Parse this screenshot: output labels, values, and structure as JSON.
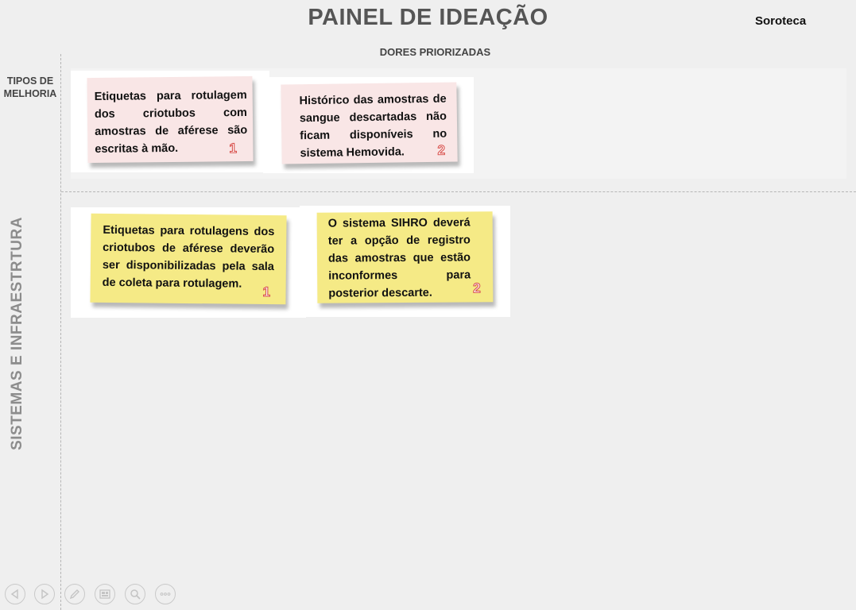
{
  "header": {
    "title": "PAINEL DE IDEAÇÃO",
    "organization": "Soroteca",
    "column_heading": "DORES PRIORIZADAS"
  },
  "rows": {
    "top_label": "TIPOS DE MELHORIA",
    "side_label": "SISTEMAS E INFRAESTRTURA"
  },
  "pain_cards": [
    {
      "text": "Etiquetas para rotulagem dos criotubos com amostras de aférese são escritas à mão.",
      "number": "1",
      "color": "#f9e6e6"
    },
    {
      "text": "Histórico das amostras de sangue descartadas não ficam disponíveis no sistema Hemovida.",
      "number": "2",
      "color": "#f9e6e6"
    }
  ],
  "idea_cards": [
    {
      "text": "Etiquetas para rotulagens dos criotubos de aférese deverão ser disponibilizadas pela sala de coleta para rotulagem.",
      "number": "1",
      "color": "#f5ea86"
    },
    {
      "text": "O sistema SIHRO deverá ter a opção de registro das amostras que estão inconformes para posterior descarte.",
      "number": "2",
      "color": "#f5ea86"
    }
  ],
  "toolbar": [
    {
      "icon": "previous-icon"
    },
    {
      "icon": "next-icon"
    },
    {
      "icon": "pen-icon"
    },
    {
      "icon": "slides-icon"
    },
    {
      "icon": "zoom-icon"
    },
    {
      "icon": "more-icon"
    }
  ]
}
